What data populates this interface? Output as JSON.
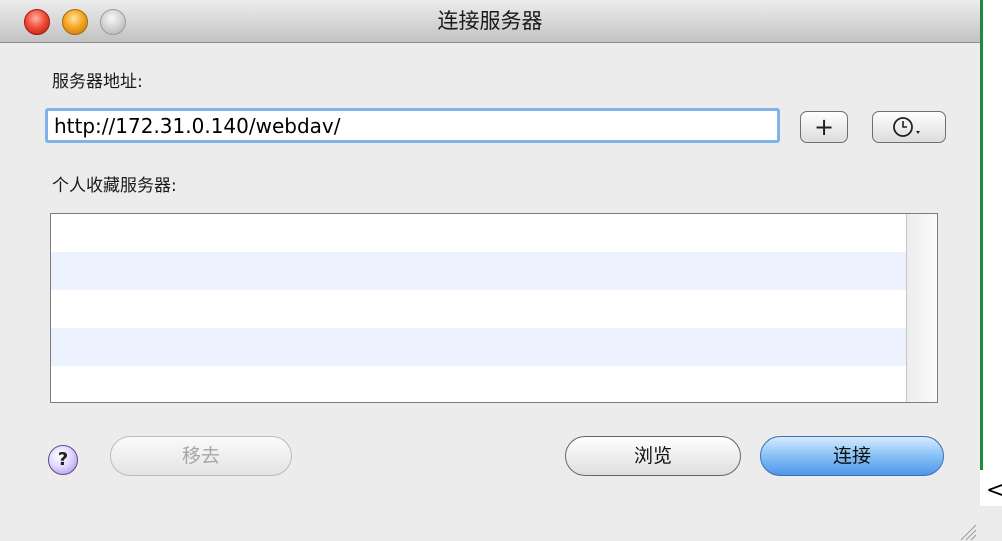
{
  "window": {
    "title": "连接服务器"
  },
  "server_address": {
    "label": "服务器地址:",
    "value": "http://172.31.0.140/webdav/"
  },
  "favorites": {
    "label": "个人收藏服务器:",
    "rows": [
      "",
      "",
      "",
      "",
      ""
    ]
  },
  "buttons": {
    "add": "+",
    "recent_icon": "clock-dropdown-icon",
    "help": "?",
    "remove": "移去",
    "browse": "浏览",
    "connect": "连接"
  },
  "stray_char": "<",
  "colors": {
    "focus_ring": "#7fb3ea",
    "default_button": "#4e97ea",
    "alt_row": "#edf3fe"
  }
}
